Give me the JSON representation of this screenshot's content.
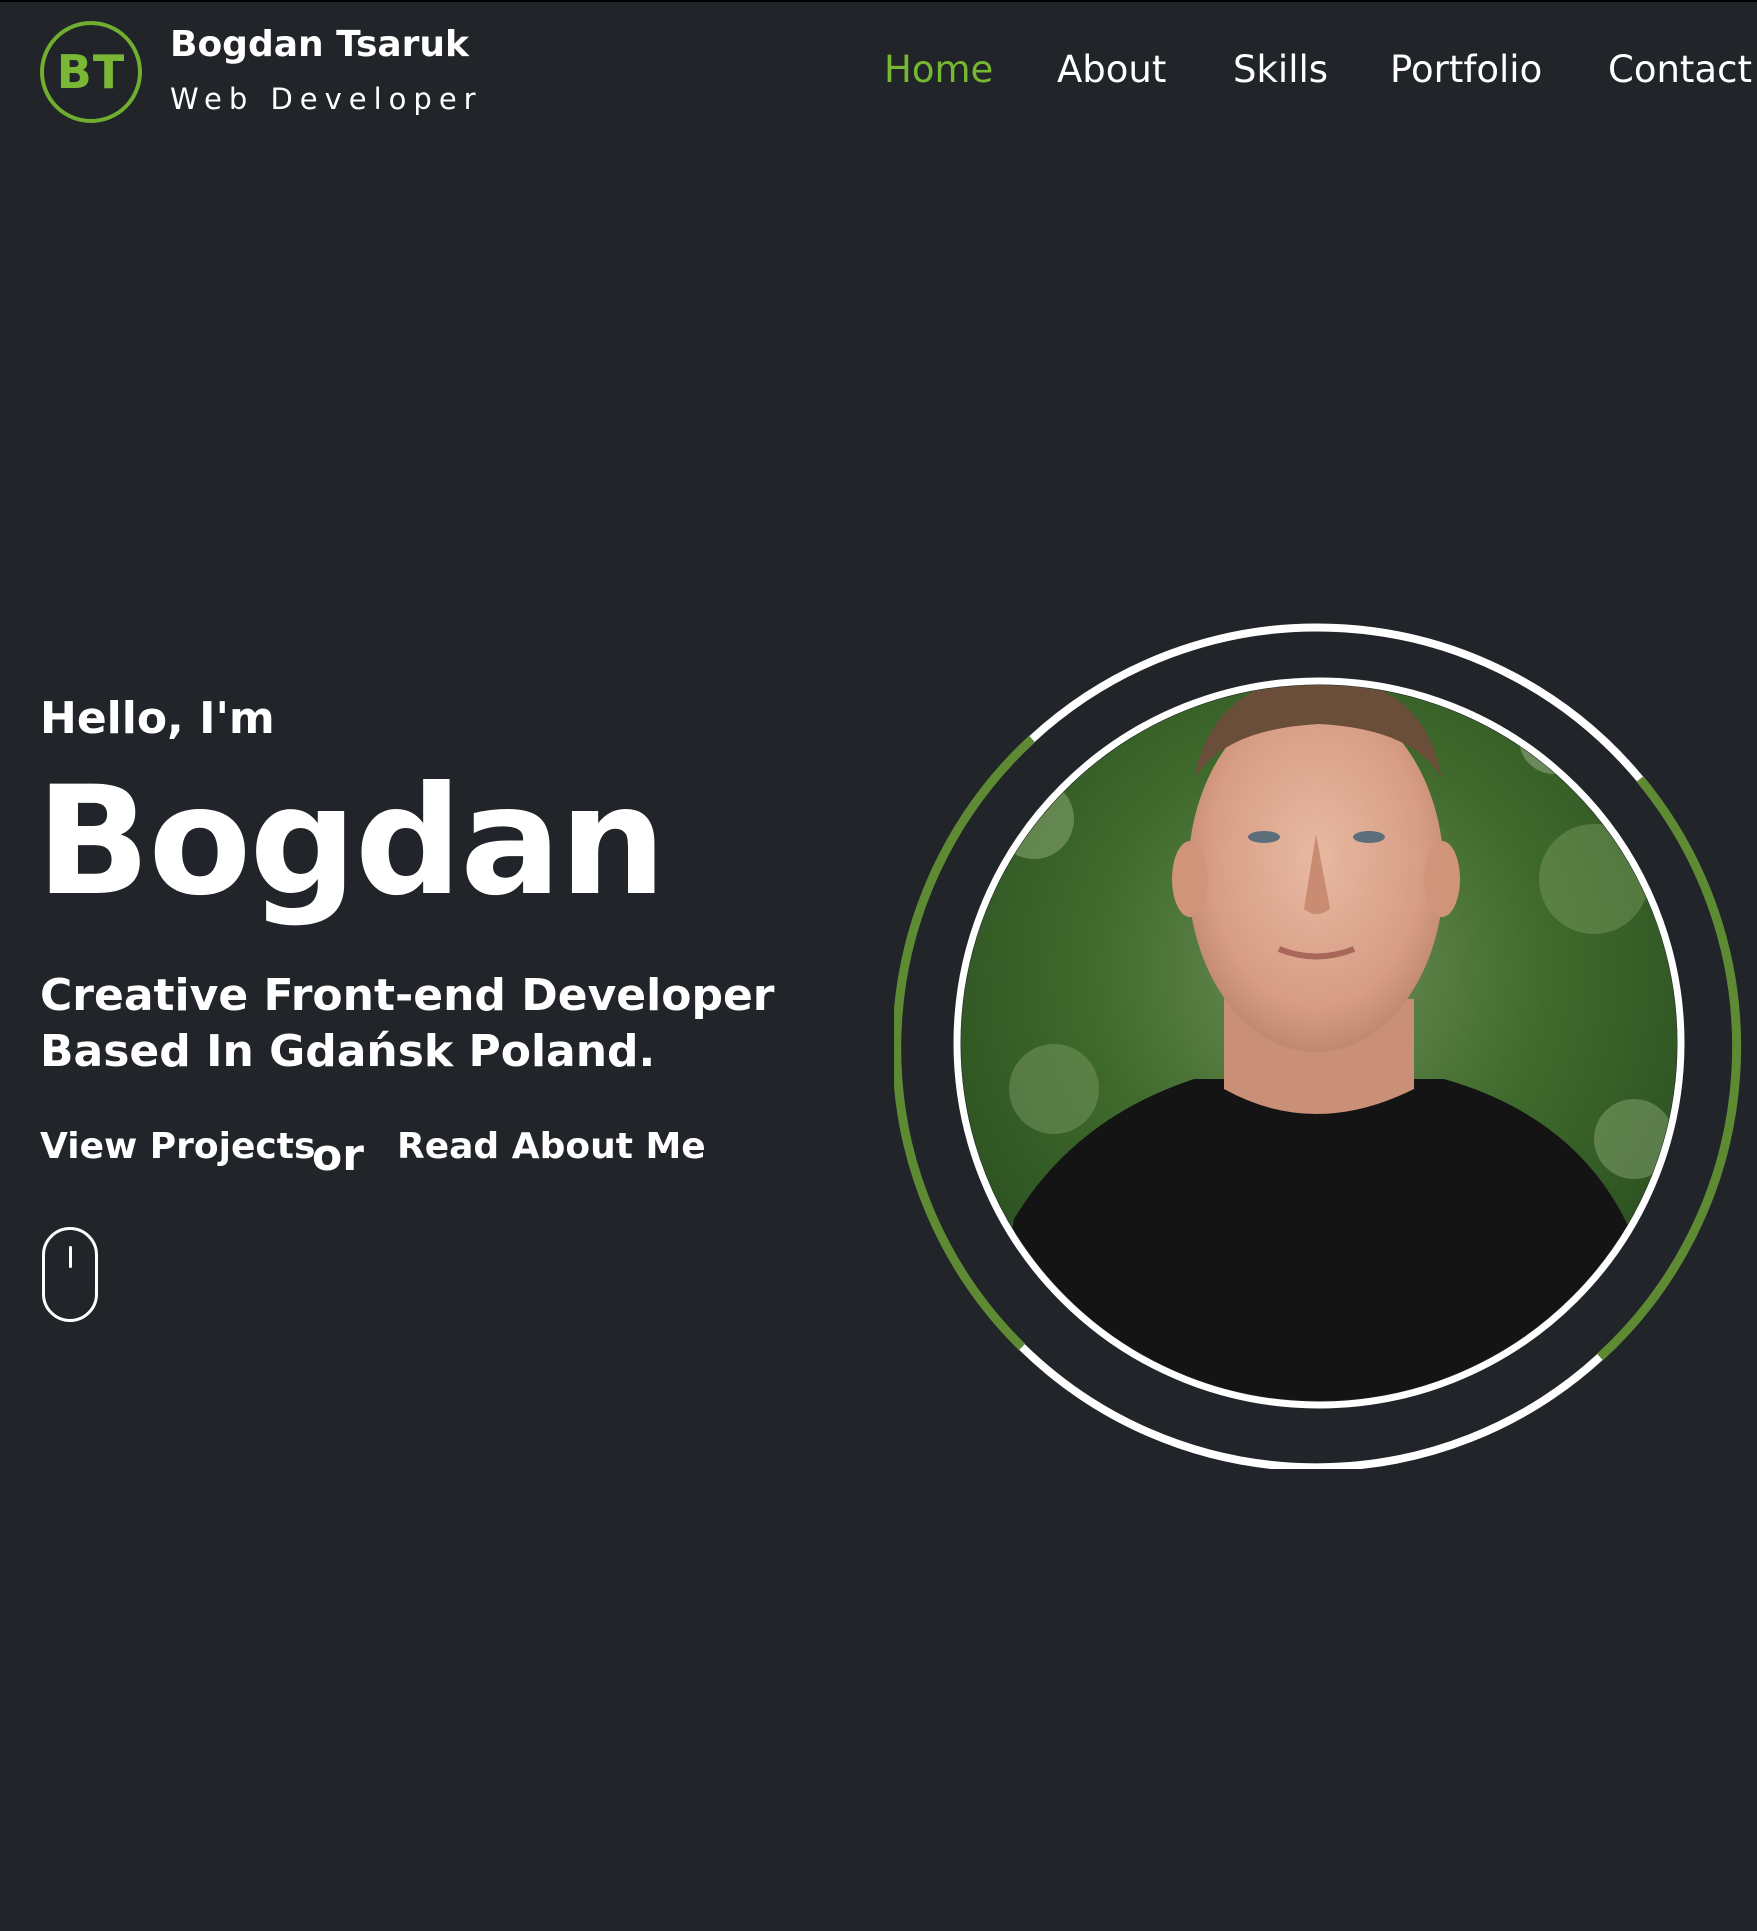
{
  "header": {
    "logo_initials": "BT",
    "name": "Bogdan Tsaruk",
    "role": "Web Developer"
  },
  "nav": {
    "items": [
      {
        "label": "Home",
        "active": true
      },
      {
        "label": "About",
        "active": false
      },
      {
        "label": "Skills",
        "active": false
      },
      {
        "label": "Portfolio",
        "active": false
      },
      {
        "label": "Contact",
        "active": false
      }
    ]
  },
  "hero": {
    "greeting": "Hello, I'm",
    "name": "Bogdan",
    "tagline_line1": "Creative Front-end Developer",
    "tagline_line2": "Based In Gdańsk Poland.",
    "cta_primary": "View Projects",
    "cta_separator": "or",
    "cta_secondary": "Read About Me"
  },
  "theme": {
    "background": "#212428",
    "accent": "#77b832",
    "ring_green": "#5e8a33",
    "text": "#ffffff"
  },
  "icons": {
    "scroll": "mouse-scroll-icon",
    "logo": "logo-monogram-icon"
  }
}
